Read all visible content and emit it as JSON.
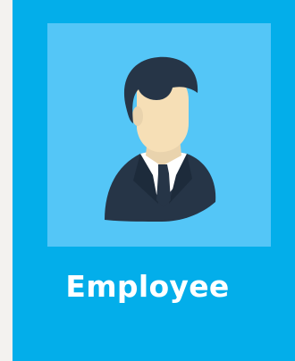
{
  "card": {
    "label": "Employee",
    "icon": "employee-avatar-icon",
    "colors": {
      "page_bg": "#f3f2ef",
      "card_bg": "#03aeea",
      "tile_bg": "#54c6f7",
      "label": "#ffffff"
    }
  }
}
